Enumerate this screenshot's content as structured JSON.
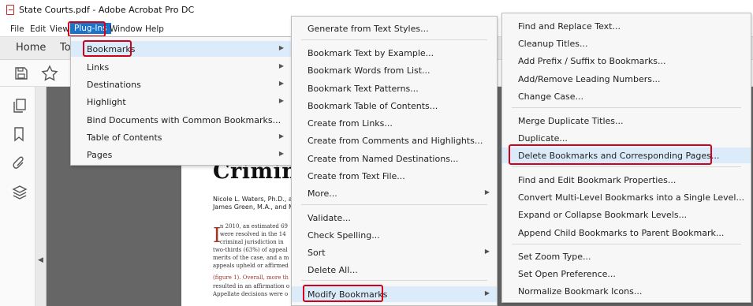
{
  "window": {
    "title": "State Courts.pdf - Adobe Acrobat Pro DC"
  },
  "menubar": {
    "items": [
      "File",
      "Edit",
      "View",
      "Plug-Ins",
      "Window",
      "Help"
    ]
  },
  "tabs": {
    "home": "Home",
    "tools": "To"
  },
  "document": {
    "heading": "Crimina",
    "authors": [
      "Nicole L. Waters, Ph.D., and",
      "James Green, M.A., and M"
    ],
    "dropcap": "I",
    "body": "    n 2010, an estimated 69\n    were resolved in the 14\n    criminal jurisdiction in\ntwo-thirds (63%) of appeal\nmerits of the case, and a m\nappeals upheld or affirmed",
    "figure_ref": "(figure 1). Overall, more th",
    "body_tail": "resulted in an affirmation o\nAppellate decisions were o"
  },
  "menu_plugins": {
    "items": [
      {
        "label": "Bookmarks",
        "submenu": true
      },
      {
        "label": "Links",
        "submenu": true
      },
      {
        "label": "Destinations",
        "submenu": true
      },
      {
        "label": "Highlight",
        "submenu": true
      },
      {
        "label": "Bind Documents with Common Bookmarks..."
      },
      {
        "label": "Table of Contents",
        "submenu": true
      },
      {
        "label": "Pages",
        "submenu": true
      }
    ]
  },
  "menu_bookmarks": {
    "items": [
      {
        "label": "Generate from Text Styles..."
      },
      {
        "label": "Bookmark Text by Example..."
      },
      {
        "label": "Bookmark Words from List..."
      },
      {
        "label": "Bookmark Text Patterns..."
      },
      {
        "label": "Bookmark Table of Contents..."
      },
      {
        "label": "Create from Links..."
      },
      {
        "label": "Create from Comments and Highlights..."
      },
      {
        "label": "Create from Named Destinations..."
      },
      {
        "label": "Create from Text File..."
      },
      {
        "label": "More...",
        "submenu": true
      },
      {
        "label": "Validate..."
      },
      {
        "label": "Check Spelling..."
      },
      {
        "label": "Sort",
        "submenu": true
      },
      {
        "label": "Delete All..."
      },
      {
        "label": "Modify Bookmarks",
        "submenu": true
      }
    ]
  },
  "menu_modify": {
    "items": [
      {
        "label": "Find and Replace Text..."
      },
      {
        "label": "Cleanup Titles..."
      },
      {
        "label": "Add Prefix / Suffix to Bookmarks..."
      },
      {
        "label": "Add/Remove Leading Numbers..."
      },
      {
        "label": "Change Case..."
      },
      {
        "label": "Merge Duplicate Titles..."
      },
      {
        "label": "Duplicate..."
      },
      {
        "label": "Delete Bookmarks and Corresponding Pages..."
      },
      {
        "label": "Find and Edit Bookmark Properties..."
      },
      {
        "label": "Convert Multi-Level Bookmarks into a Single Level..."
      },
      {
        "label": "Expand or Collapse Bookmark Levels..."
      },
      {
        "label": "Append Child Bookmarks to Parent Bookmark..."
      },
      {
        "label": "Set Zoom Type..."
      },
      {
        "label": "Set Open Preference..."
      },
      {
        "label": "Normalize Bookmark Icons..."
      }
    ]
  },
  "icons": {
    "save": "save-icon",
    "star": "star-icon",
    "pages": "pages-icon",
    "bookmark": "bookmark-icon",
    "attachment": "paperclip-icon",
    "layers": "layers-icon",
    "collapse": "chevron-left-icon",
    "submenu": "chevron-right-icon"
  },
  "colors": {
    "highlight_box": "#d0021b",
    "menubar_active": "#1a73c8",
    "menu_selected": "#dcebfa"
  }
}
